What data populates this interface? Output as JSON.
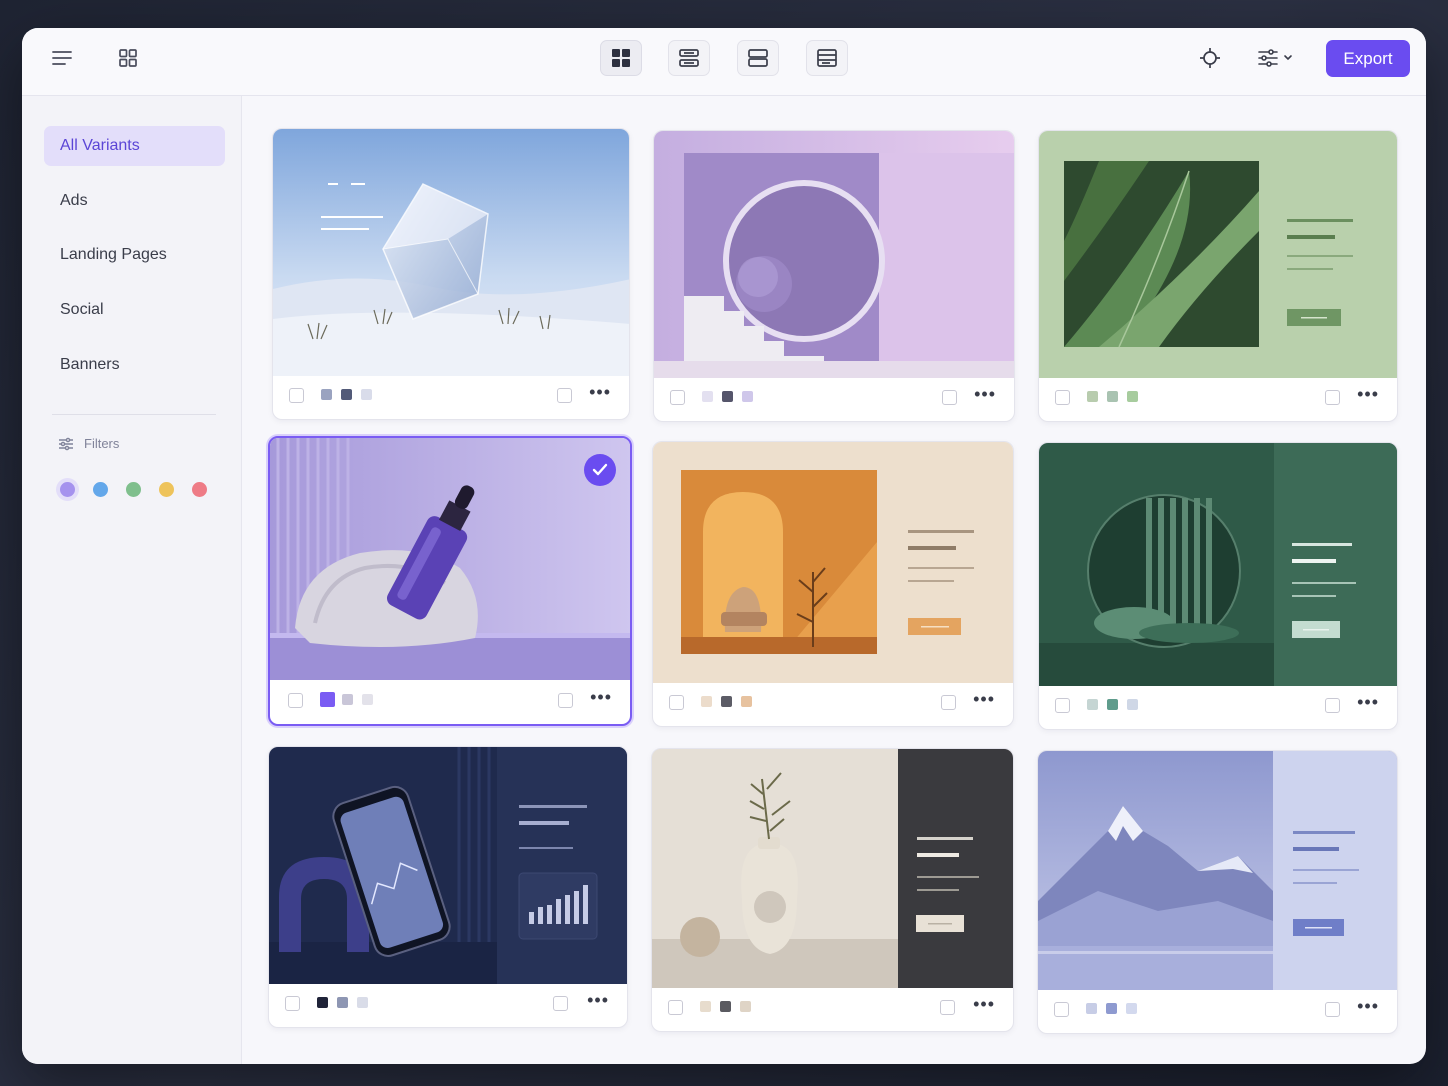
{
  "toolbar": {
    "export_label": "Export"
  },
  "sidebar": {
    "items": [
      {
        "label": "All Variants",
        "active": true
      },
      {
        "label": "Ads",
        "active": false
      },
      {
        "label": "Landing Pages",
        "active": false
      },
      {
        "label": "Social",
        "active": false
      },
      {
        "label": "Banners",
        "active": false
      }
    ],
    "filters_label": "Filters",
    "filter_colors": [
      "#a592ee",
      "#63a7ea",
      "#7fbf8d",
      "#eec35b",
      "#ee7b86"
    ]
  },
  "cards": [
    {
      "name": "glass-cube-desert",
      "swatches": [
        "#9aa3c0",
        "#525a78",
        "#d9dcea"
      ],
      "selected": false
    },
    {
      "name": "purple-arch-sphere",
      "swatches": [
        "#e3e0f0",
        "#55556b",
        "#cfc7ea"
      ],
      "selected": false
    },
    {
      "name": "green-leaf-layout",
      "swatches": [
        "#b8ccae",
        "#a9c3b1",
        "#a7cc9e"
      ],
      "selected": false
    },
    {
      "name": "serum-bottle-rock",
      "swatches": [
        "#7a5cf3",
        "#c9c6d8",
        "#e3e2ea"
      ],
      "selected": true
    },
    {
      "name": "orange-arch-chair",
      "swatches": [
        "#ecdccb",
        "#5c5c66",
        "#e7c29f"
      ],
      "selected": false
    },
    {
      "name": "green-circle-cushion",
      "swatches": [
        "#c5d5d3",
        "#5f9c8c",
        "#cfd7e6"
      ],
      "selected": false
    },
    {
      "name": "phone-analytics",
      "swatches": [
        "#1f2338",
        "#8e96b3",
        "#d9dce8"
      ],
      "selected": false
    },
    {
      "name": "ceramic-vase",
      "swatches": [
        "#e7dccd",
        "#5a5a60",
        "#dfd4c6"
      ],
      "selected": false
    },
    {
      "name": "mountain-lake",
      "swatches": [
        "#c7cde6",
        "#8e9ad0",
        "#d3d9ee"
      ],
      "selected": false
    }
  ]
}
